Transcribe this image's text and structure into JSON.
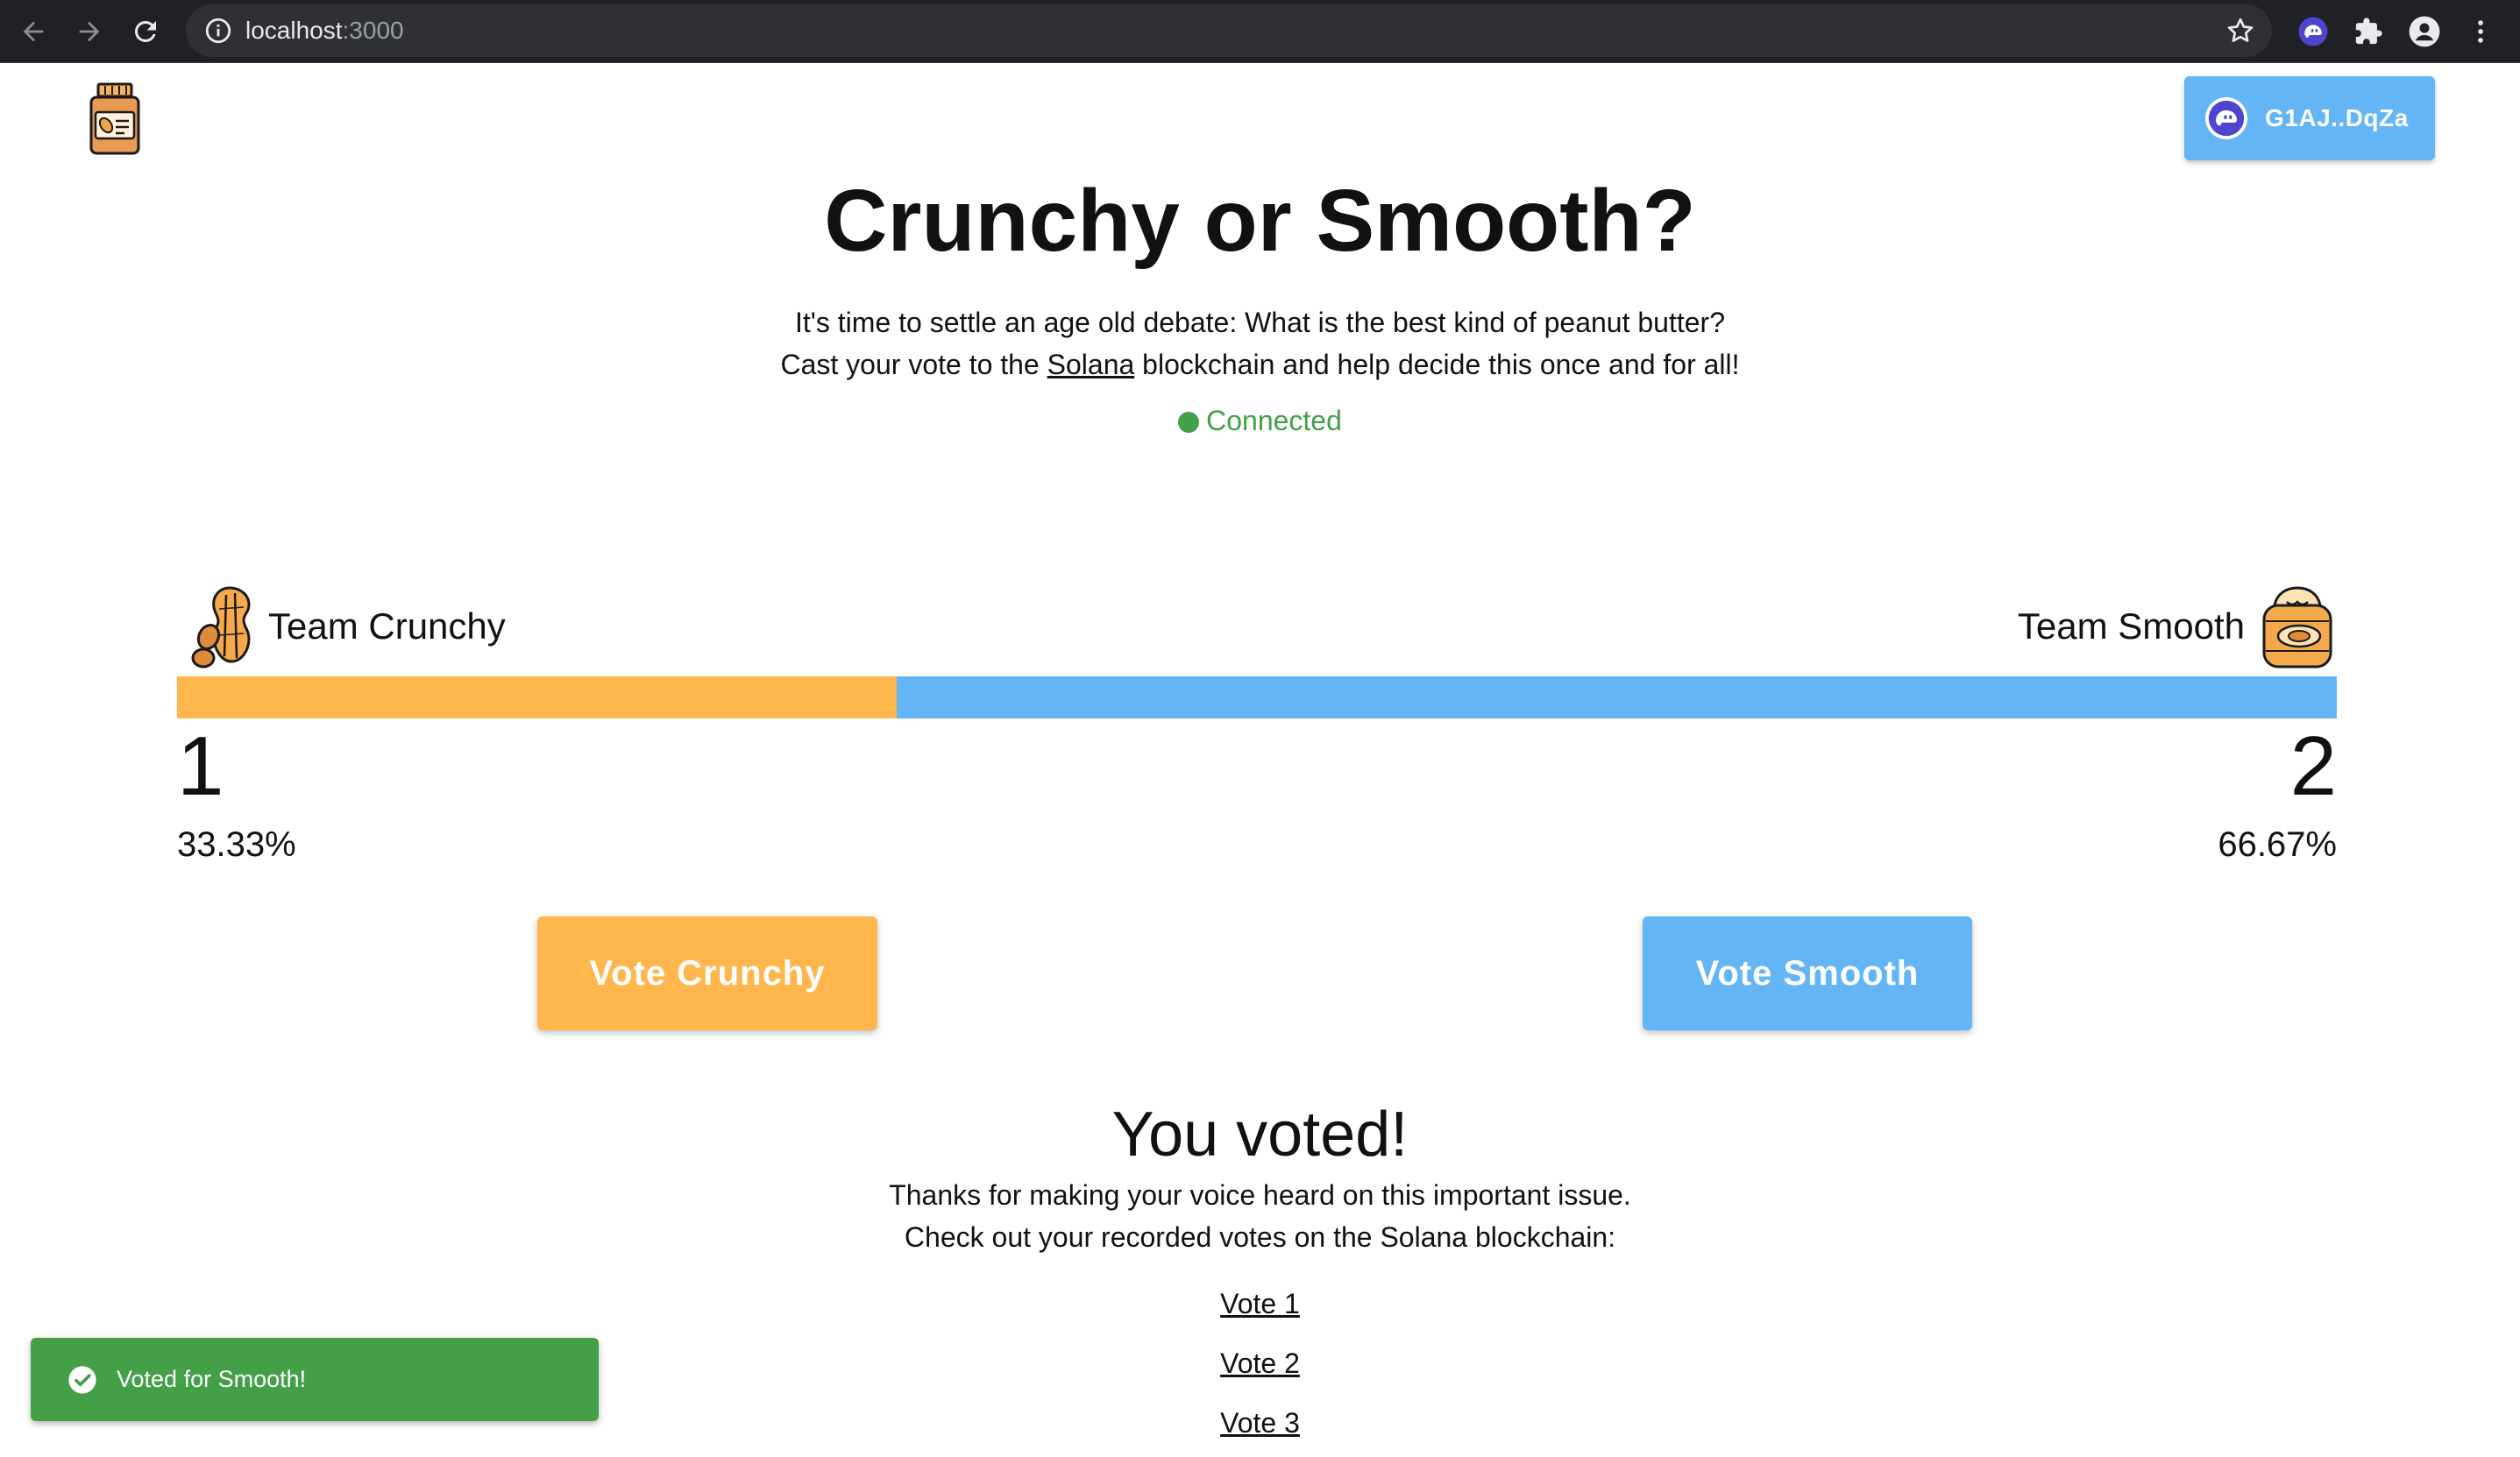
{
  "browser": {
    "url_host": "localhost",
    "url_port": ":3000"
  },
  "header": {
    "wallet_label": "G1AJ..DqZa"
  },
  "main": {
    "title": "Crunchy or Smooth?",
    "intro_line1": "It's time to settle an age old debate: What is the best kind of peanut butter?",
    "intro_line2_before": "Cast your vote to the ",
    "intro_link": "Solana",
    "intro_line2_after": " blockchain and help decide this once and for all!",
    "status": "Connected"
  },
  "teams": {
    "crunchy": {
      "name": "Team Crunchy",
      "votes": "1",
      "percent": "33.33%",
      "share": 0.3333,
      "color": "#ffb74d"
    },
    "smooth": {
      "name": "Team Smooth",
      "votes": "2",
      "percent": "66.67%",
      "share": 0.6667,
      "color": "#64b5f6"
    }
  },
  "buttons": {
    "vote_crunchy": "Vote Crunchy",
    "vote_smooth": "Vote Smooth"
  },
  "result": {
    "title": "You voted!",
    "line1": "Thanks for making your voice heard on this important issue.",
    "line2": "Check out your recorded votes on the Solana blockchain:",
    "votes": [
      "Vote 1",
      "Vote 2",
      "Vote 3"
    ]
  },
  "toast": {
    "message": "Voted for Smooth!",
    "color": "#43a047"
  }
}
